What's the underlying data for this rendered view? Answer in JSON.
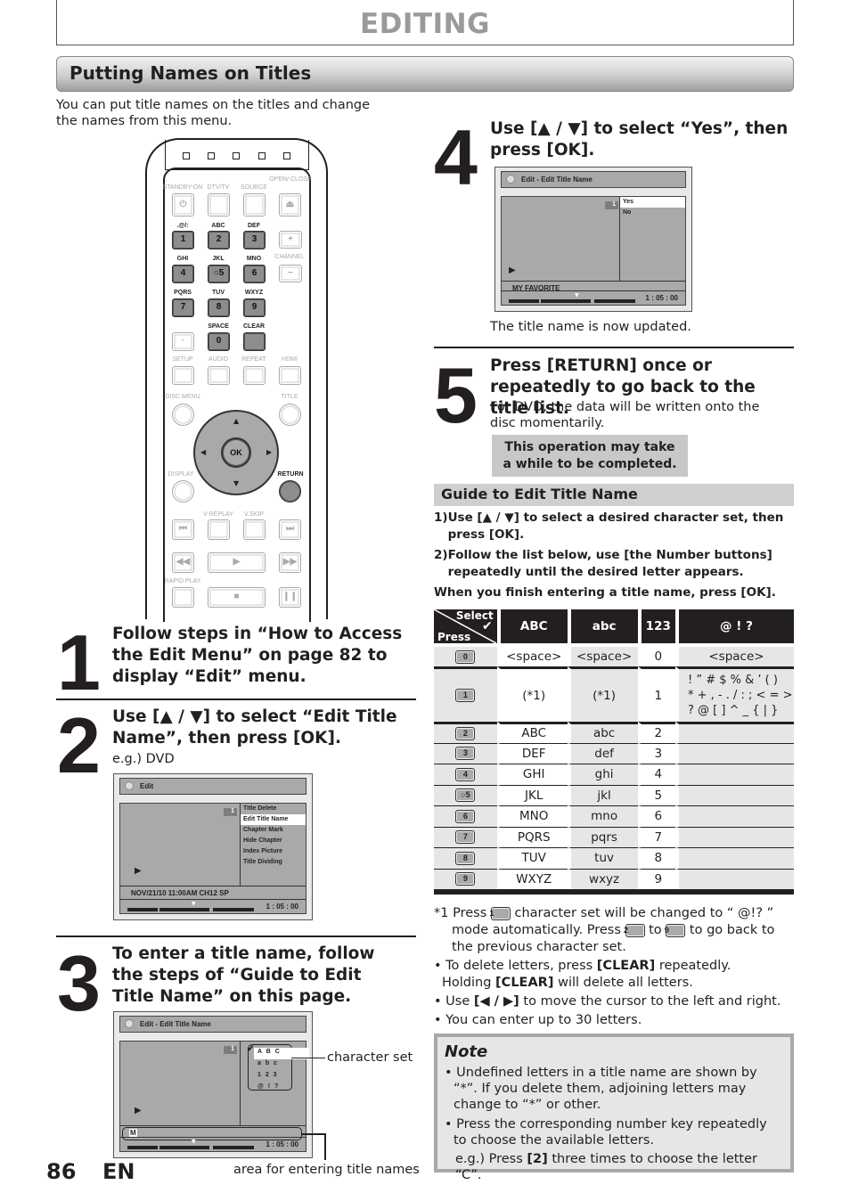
{
  "header": {
    "title": "EDITING"
  },
  "section": {
    "title": "Putting Names on Titles"
  },
  "intro": "You can put title names on the titles and change the names from this menu.",
  "remote": {
    "labels": [
      "STANDBY-ON",
      "DTV/TV",
      "SOURCE",
      "OPEN/ CLOSE",
      ".@/:",
      "ABC",
      "DEF",
      "GHI",
      "JKL",
      "MNO",
      "PQRS",
      "TUV",
      "WXYZ",
      "SPACE",
      "CLEAR",
      "SETUP",
      "AUDIO",
      "REPEAT",
      "HDMI",
      "DISC MENU",
      "TITLE",
      "DISPLAY",
      "RETURN",
      "V REPLAY",
      "V.SKIP",
      "RAPID PLAY",
      "CHANNEL"
    ],
    "keys": [
      "1",
      "2",
      "3",
      "4",
      "○5",
      "6",
      "7",
      "8",
      "9",
      "0",
      "·",
      "OK",
      "+",
      "−"
    ]
  },
  "steps": [
    {
      "num": "1",
      "title": "Follow steps in “How to Access the Edit Menu” on page 82 to display “Edit” menu."
    },
    {
      "num": "2",
      "title": "Use [▲ / ▼] to select “Edit Title Name”, then press [OK].",
      "sub": "e.g.) DVD"
    },
    {
      "num": "3",
      "title": "To enter a title name, follow the steps of “Guide to Edit Title Name” on this page."
    },
    {
      "num": "4",
      "title": "Use [▲ / ▼] to select “Yes”, then press [OK].",
      "sub": "The title name is now updated."
    },
    {
      "num": "5",
      "title": "Press [RETURN] once or repeatedly to go back to the title list.",
      "sub": "For DVD, the data will be written onto the disc momentarily.",
      "box": "This operation may take a while to be completed."
    }
  ],
  "screen_edit": {
    "bar": "Edit",
    "num": "1",
    "menu": [
      "Title Delete",
      "Edit Title Name",
      "Chapter Mark",
      "Hide Chapter",
      "Index Picture",
      "Title Dividing"
    ],
    "selected": 1,
    "info": "NOV/21/10 11:00AM CH12 SP",
    "time": "1 : 05 : 00"
  },
  "screen_charset": {
    "bar": "Edit - Edit Title Name",
    "num": "1",
    "rows": [
      "A B C",
      "a b c",
      "1 2 3",
      "@ ! ?"
    ],
    "entry": "M",
    "time": "1 : 05 : 00",
    "callout_charset": "character set",
    "callout_area": "area for entering title names"
  },
  "screen_yes": {
    "bar": "Edit - Edit Title Name",
    "num": "1",
    "menu": [
      "Yes",
      "No"
    ],
    "selected": 0,
    "info": "MY FAVORITE",
    "time": "1 : 05 : 00"
  },
  "guide": {
    "title": "Guide to Edit Title Name",
    "items": [
      {
        "n": "1)",
        "t": "Use [▲ / ▼] to select a desired character set, then press [OK]."
      },
      {
        "n": "2)",
        "t": "Follow the list below, use [the Number buttons] repeatedly until the desired letter appears."
      }
    ],
    "finish": "When you finish entering a title name, press [OK]."
  },
  "table": {
    "corner_select": "Select",
    "corner_press": "Press",
    "headers": [
      "ABC",
      "abc",
      "123",
      "@ ! ?"
    ],
    "rows": [
      {
        "key": "0",
        "c": [
          "<space>",
          "<space>",
          "0",
          "<space>"
        ]
      },
      {
        "key": "1",
        "c": [
          "(*1)",
          "(*1)",
          "1",
          "! ” # $ % & ’ ( )\n* + , - . / : ; < = >\n? @ [ ] ^ _ { | }"
        ]
      },
      {
        "key": "2",
        "c": [
          "ABC",
          "abc",
          "2",
          ""
        ]
      },
      {
        "key": "3",
        "c": [
          "DEF",
          "def",
          "3",
          ""
        ]
      },
      {
        "key": "4",
        "c": [
          "GHI",
          "ghi",
          "4",
          ""
        ]
      },
      {
        "key": "○5",
        "c": [
          "JKL",
          "jkl",
          "5",
          ""
        ]
      },
      {
        "key": "6",
        "c": [
          "MNO",
          "mno",
          "6",
          ""
        ]
      },
      {
        "key": "7",
        "c": [
          "PQRS",
          "pqrs",
          "7",
          ""
        ]
      },
      {
        "key": "8",
        "c": [
          "TUV",
          "tuv",
          "8",
          ""
        ]
      },
      {
        "key": "9",
        "c": [
          "WXYZ",
          "wxyz",
          "9",
          ""
        ]
      }
    ]
  },
  "footnotes": {
    "fn1_a": "*1 Press",
    "fn1_key": "1",
    "fn1_b": "character set will be changed to “ @!? ” mode automatically. Press",
    "fn1_key2": "2",
    "fn1_to": "to",
    "fn1_key3": "9",
    "fn1_c": "to go back to the previous character set.",
    "b1a": "• To delete letters, press ",
    "b1b": "[CLEAR]",
    "b1c": " repeatedly.",
    "b1d": "Holding ",
    "b1e": "[CLEAR]",
    "b1f": " will delete all letters.",
    "b2a": "• Use ",
    "b2b": "[◀ / ▶]",
    "b2c": " to move the cursor to the left and right.",
    "b3": "• You can enter up to 30 letters."
  },
  "note": {
    "title": "Note",
    "items": [
      "Undefined letters in a title name are shown by “*”. If you delete them, adjoining letters may change to “*” or other.",
      "Press the corresponding number key repeatedly to choose the available letters."
    ],
    "eg_a": "e.g.) Press ",
    "eg_b": "[2]",
    "eg_c": " three times to choose the letter “C”."
  },
  "footer": {
    "page": "86",
    "lang": "EN"
  }
}
